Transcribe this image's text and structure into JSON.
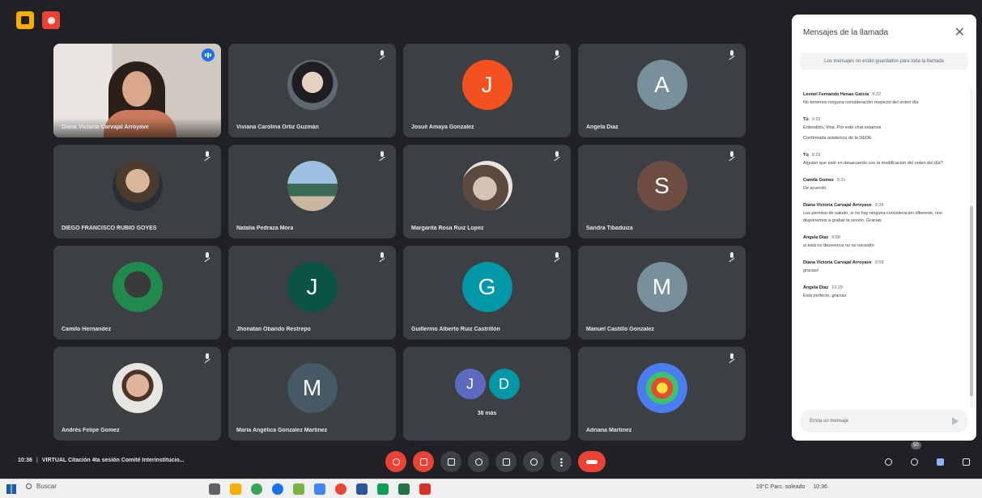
{
  "colors": {
    "background": "#202124",
    "tile": "#3c4043",
    "accent_blue": "#8ab4f8",
    "hangup_red": "#ea4335"
  },
  "participants": [
    {
      "name": "Diana Victoria Carvajal Arroyave",
      "type": "video",
      "speaking": true
    },
    {
      "name": "Viviana Carolina Ortiz Guzmán",
      "type": "photo",
      "photo": "p2"
    },
    {
      "name": "Josué Amaya Gonzalez",
      "type": "letter",
      "letter": "J",
      "color": "#f4511e"
    },
    {
      "name": "Angela Diaz",
      "type": "letter",
      "letter": "A",
      "color": "#78909c"
    },
    {
      "name": "DIEGO FRANCISCO RUBIO GOYES",
      "type": "photo",
      "photo": "p1"
    },
    {
      "name": "Natalia Pedraza Mora",
      "type": "photo",
      "photo": "p3"
    },
    {
      "name": "Margarita Rosa Ruiz Lopez",
      "type": "photo",
      "photo": "p4"
    },
    {
      "name": "Sandra Tibaduiza",
      "type": "letter",
      "letter": "S",
      "color": "#6d4c41"
    },
    {
      "name": "Camilo Hernandez",
      "type": "photo",
      "photo": "p5"
    },
    {
      "name": "Jhonatan Obando Restrepo",
      "type": "letter",
      "letter": "J",
      "color": "#0b5345"
    },
    {
      "name": "Guillermo Alberto Ruiz Castrillón",
      "type": "letter",
      "letter": "G",
      "color": "#0097a7"
    },
    {
      "name": "Manuel Castillo Gonzalez",
      "type": "letter",
      "letter": "M",
      "color": "#78909c"
    },
    {
      "name": "Andrés Felipe Gomez",
      "type": "photo",
      "photo": "p6"
    },
    {
      "name": "María Angélica Gonzalez Martinez",
      "type": "letter",
      "letter": "M",
      "color": "#455a64"
    },
    {
      "name": "38 más",
      "type": "duo",
      "letters": [
        "J",
        "D"
      ],
      "colors": [
        "#5c6bc0",
        "#0097a7"
      ]
    },
    {
      "name": "Adriana Martinez",
      "type": "photo",
      "photo": "p7"
    }
  ],
  "chat": {
    "title": "Mensajes de la llamada",
    "notice": "Los mensajes no están guardados para toda la llamada",
    "messages": [
      {
        "sender": "Leonel Fernando Henao Garcia",
        "time": "9:22",
        "lines": [
          "No tenemos ninguna consideración respecto del orden día"
        ]
      },
      {
        "sender": "Tú",
        "time": "9:22",
        "lines": [
          "Entendido, Vina. Por este chat estamos",
          "Confirmada asistencia de la DEDE"
        ]
      },
      {
        "sender": "Tú",
        "time": "9:29",
        "lines": [
          "Alguien que esté en desacuerdo con la modificación del orden del día?"
        ]
      },
      {
        "sender": "Camila Gomez",
        "time": "9:31",
        "lines": [
          "De acuerdo"
        ]
      },
      {
        "sender": "Diana Victoria Carvajal Arroyave",
        "time": "9:38",
        "lines": [
          "Los permiso de saludo, si no hay ninguna consideración diferente, nos disponemos a grabar la sesión. Gracias"
        ]
      },
      {
        "sender": "Angela Diaz",
        "time": "9:58",
        "lines": [
          "si está no deseemos no no necesito"
        ]
      },
      {
        "sender": "Diana Victoria Carvajal Arroyave",
        "time": "9:59",
        "lines": [
          "gracias!"
        ]
      },
      {
        "sender": "Angela Diaz",
        "time": "10:29",
        "lines": [
          "Está perfecto, gracias"
        ]
      }
    ],
    "input_placeholder": "Envía un mensaje"
  },
  "bottom": {
    "time": "10:36",
    "meeting_title": "VIRTUAL Citación 4ta sesión Comité Interinstitucio...",
    "people_count": "50"
  },
  "taskbar": {
    "search_placeholder": "Buscar",
    "tray_text": "19°C Parc. soleado",
    "clock": "10:36"
  }
}
